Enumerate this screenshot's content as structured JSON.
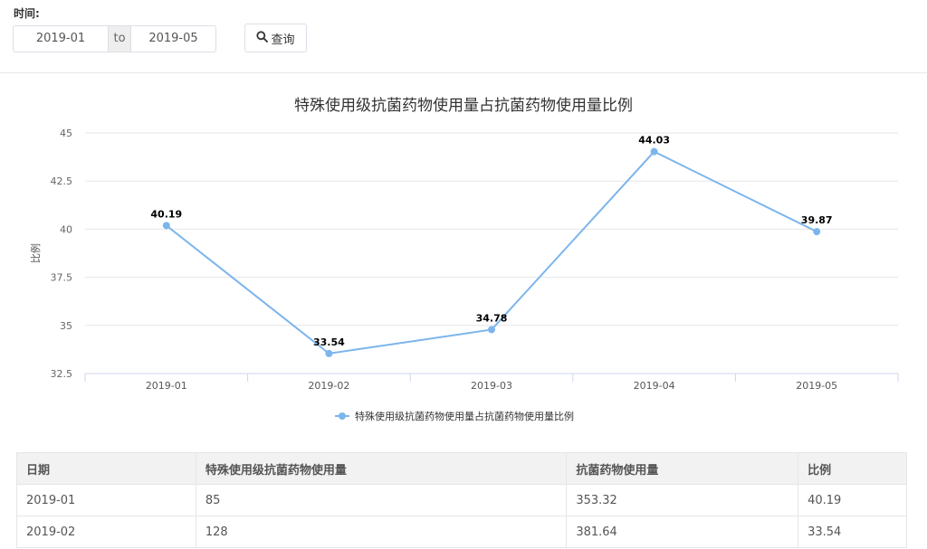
{
  "filter": {
    "label": "时间:",
    "start": "2019-01",
    "separator": "to",
    "end": "2019-05",
    "query_label": "查询"
  },
  "chart_data": {
    "type": "line",
    "title": "特殊使用级抗菌药物使用量占抗菌药物使用量比例",
    "ylabel": "比例",
    "xlabel": "",
    "categories": [
      "2019-01",
      "2019-02",
      "2019-03",
      "2019-04",
      "2019-05"
    ],
    "series": [
      {
        "name": "特殊使用级抗菌药物使用量占抗菌药物使用量比例",
        "values": [
          40.19,
          33.54,
          34.78,
          44.03,
          39.87
        ],
        "color": "#7cb5ec"
      }
    ],
    "yticks": [
      "32.5",
      "35",
      "37.5",
      "40",
      "42.5",
      "45"
    ],
    "ylim": [
      32.5,
      45
    ],
    "grid": true,
    "legend": "bottom-center"
  },
  "table": {
    "headers": [
      "日期",
      "特殊使用级抗菌药物使用量",
      "抗菌药物使用量",
      "比例"
    ],
    "rows": [
      [
        "2019-01",
        "85",
        "353.32",
        "40.19"
      ],
      [
        "2019-02",
        "128",
        "381.64",
        "33.54"
      ]
    ]
  }
}
